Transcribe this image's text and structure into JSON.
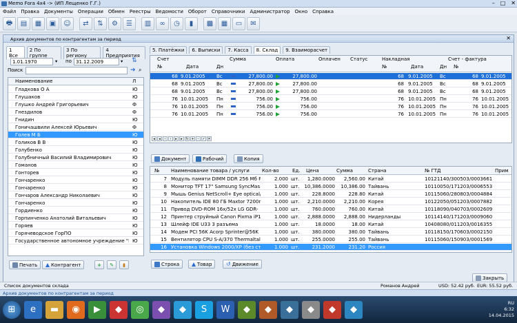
{
  "window": {
    "title": "Memo Fora 4x4 -> (ИП Лещенко Г.Г.)"
  },
  "menu": [
    "Файл",
    "Правка",
    "Документы",
    "Операции",
    "Обмен",
    "Реестры",
    "Ведомости",
    "Оборот",
    "Справочники",
    "Администратор",
    "Окно",
    "Справка"
  ],
  "toolbar_icons": [
    "printer-icon",
    "page-icon",
    "table-icon",
    "document-icon",
    "user-icon",
    "transfer-icon",
    "transfer-icon",
    "gear-icon",
    "list-icon",
    "grid-icon",
    "binoculars-icon",
    "clock-icon",
    "barcode-icon",
    "chip-icon",
    "table-icon",
    "chat-icon",
    "mail-icon"
  ],
  "doc": {
    "title": "Архив документов по контрагентам за период"
  },
  "left": {
    "tabs": [
      "1 Все",
      "2 По группе",
      "3 По региону",
      "4 Предприятия"
    ],
    "date_from": "1.01.1970",
    "date_to": "31.12.2009",
    "po": "по",
    "search_label": "Поиск",
    "col_name": "Наименование",
    "col_type": "Л",
    "rows": [
      {
        "name": "Гладкова О А",
        "t": "Ю"
      },
      {
        "name": "Глушаков",
        "t": "Ю"
      },
      {
        "name": "Глушко Андрей Григорьевич",
        "t": "Ф"
      },
      {
        "name": "Гнездилов",
        "t": "Ф"
      },
      {
        "name": "Гнидин",
        "t": "Ю"
      },
      {
        "name": "Гоничашвили Алексей Юрьевич",
        "t": "Ф"
      },
      {
        "name": "Голев М Б",
        "t": "Ю"
      },
      {
        "name": "Голиков В В",
        "t": "Ю"
      },
      {
        "name": "Голубенко",
        "t": "Ю"
      },
      {
        "name": "Голубничный Василий Владимирович",
        "t": "Ю"
      },
      {
        "name": "Гоманов",
        "t": "Ю"
      },
      {
        "name": "Гонторев",
        "t": "Ю"
      },
      {
        "name": "Гончаренко",
        "t": "Ю"
      },
      {
        "name": "Гончаренко",
        "t": "Ю"
      },
      {
        "name": "Гончаров Александр Николаевич",
        "t": "Ю"
      },
      {
        "name": "Гончаренко",
        "t": "Ю"
      },
      {
        "name": "Гордиенко",
        "t": "Ю"
      },
      {
        "name": "Горпинченко Анатолий Витальевич",
        "t": "Ю"
      },
      {
        "name": "Горяев",
        "t": "Ю"
      },
      {
        "name": "Горячеводское ГорПО",
        "t": "Ю"
      },
      {
        "name": "Государственное автономное учреждение \"Бо",
        "t": "Ю"
      }
    ],
    "print_btn": "Печать",
    "contragent_btn": "Контрагент"
  },
  "right": {
    "tabs": [
      "5. Платёжки",
      "6. Выписки",
      "7. Касса",
      "8. Склад",
      "9. Взаиморасчет"
    ],
    "head1": {
      "schet": "Счет",
      "nakl": "Накладная",
      "sf": "Счет - фактура"
    },
    "head2": {
      "n": "№",
      "date": "Дата",
      "dn": "Дн",
      "sum": "Сумма",
      "opl": "Оплата",
      "oplachen": "Оплачен",
      "status": "Статус",
      "n2": "№",
      "date2": "Дата",
      "dn2": "Дн",
      "n3": "№"
    },
    "rows": [
      {
        "n": "68",
        "date": "9.01.2005",
        "dn": "Вс",
        "sum": "27,800.00",
        "opl": "27,800.00",
        "n2": "68",
        "date2": "9.01.2005",
        "dn2": "Вс",
        "n3": "68",
        "date3": "9.01.2005"
      },
      {
        "n": "68",
        "date": "9.01.2005",
        "dn": "Вс",
        "sum": "27,800.00",
        "opl": "27,800.00",
        "n2": "68",
        "date2": "9.01.2005",
        "dn2": "Вс",
        "n3": "68",
        "date3": "9.01.2005"
      },
      {
        "n": "68",
        "date": "9.01.2005",
        "dn": "Вс",
        "sum": "27,800.00",
        "opl": "27,800.00",
        "n2": "68",
        "date2": "9.01.2005",
        "dn2": "Вс",
        "n3": "68",
        "date3": "9.01.2005"
      },
      {
        "n": "76",
        "date": "10.01.2005",
        "dn": "Пн",
        "sum": "756.00",
        "opl": "756.00",
        "n2": "76",
        "date2": "10.01.2005",
        "dn2": "Пн",
        "n3": "76",
        "date3": "10.01.2005"
      },
      {
        "n": "76",
        "date": "10.01.2005",
        "dn": "Пн",
        "sum": "756.00",
        "opl": "756.00",
        "n2": "76",
        "date2": "10.01.2005",
        "dn2": "Пн",
        "n3": "76",
        "date3": "10.01.2005"
      },
      {
        "n": "76",
        "date": "10.01.2005",
        "dn": "Пн",
        "sum": "756.00",
        "opl": "756.00",
        "n2": "76",
        "date2": "10.01.2005",
        "dn2": "Пн",
        "n3": "76",
        "date3": "10.01.2005"
      }
    ],
    "btn_doc": "Документ",
    "btn_work": "Рабочий",
    "btn_copy": "Копия",
    "items_head": {
      "n": "№",
      "name": "Наименование товара / услуги",
      "qty": "Кол-во",
      "unit": "Ед.",
      "price": "Цена",
      "sum": "Сумма",
      "country": "Страна",
      "gtd": "№ ГТД",
      "prim": "Прим"
    },
    "items": [
      {
        "n": "7",
        "name": "Модуль памяти DIMM DDR 256 Mб P",
        "qty": "2.000",
        "unit": "шт.",
        "price": "1,280.0000",
        "sum": "2,560.00",
        "country": "Китай",
        "gtd": "10121140/300503/0003661"
      },
      {
        "n": "8",
        "name": "Монитор TFT 17\" Samsung SyncMas",
        "qty": "1.000",
        "unit": "шт.",
        "price": "10,386.0000",
        "sum": "10,386.00",
        "country": "Тайвань",
        "gtd": "10110050/171203/0006553"
      },
      {
        "n": "9",
        "name": "Мышь Genius NetScroll+ Eye optical/3",
        "qty": "1.000",
        "unit": "шт.",
        "price": "228.8000",
        "sum": "228.80",
        "country": "Китай",
        "gtd": "10115060/280803/0004884"
      },
      {
        "n": "10",
        "name": "Накопитель IDE 80 ГБ Maxtor 7200rp",
        "qty": "1.000",
        "unit": "шт.",
        "price": "2,210.0000",
        "sum": "2,210.00",
        "country": "Корея",
        "gtd": "10122050/051203/0007882"
      },
      {
        "n": "11",
        "name": "Привод DVD-ROM 16x/52x LG GDR-",
        "qty": "1.000",
        "unit": "шт.",
        "price": "760.0000",
        "sum": "760.00",
        "country": "Китай",
        "gtd": "10118090/040703/0002609"
      },
      {
        "n": "12",
        "name": "Принтер струйный Canon Pixma iP1",
        "qty": "1.000",
        "unit": "шт.",
        "price": "2,888.0000",
        "sum": "2,888.00",
        "country": "Нидерланды",
        "gtd": "10114140/171203/0009060"
      },
      {
        "n": "13",
        "name": "Шлейф IDE U33 3 разъема",
        "qty": "1.000",
        "unit": "шт.",
        "price": "18.0000",
        "sum": "18.00",
        "country": "Китай",
        "gtd": "10408080/011203/0016355"
      },
      {
        "n": "14",
        "name": "Модем PCI 56K Acorp Sprinter@56K",
        "qty": "1.000",
        "unit": "шт.",
        "price": "380.0000",
        "sum": "380.00",
        "country": "Тайвань",
        "gtd": "10118150/170603/0002150"
      },
      {
        "n": "15",
        "name": "Вентилятор CPU S-A/370 Thermaltal",
        "qty": "1.000",
        "unit": "шт.",
        "price": "255.0000",
        "sum": "255.00",
        "country": "Тайвань",
        "gtd": "10115060/150903/0001569"
      },
      {
        "n": "16",
        "name": "Установка Windows 2000/XP (без ст",
        "qty": "1.000",
        "unit": "шт.",
        "price": "231.2000",
        "sum": "231.20",
        "country": "Россия",
        "gtd": ""
      }
    ],
    "btn_row": "Строка",
    "btn_goods": "Товар",
    "btn_move": "Движение",
    "close_btn": "Закрыть"
  },
  "status": {
    "left": "Список документов склада",
    "user": "Романов Андрей",
    "usd": "USD: 52.42 руб.",
    "eur": "EUR: 55.52 руб."
  },
  "taskdoc": "Архив документов по контрагентам за период",
  "tray": {
    "lang": "RU",
    "time": "6:32",
    "date": "14.04.2015"
  },
  "taskbar_icons": [
    "start-icon",
    "ie-icon",
    "folder-icon",
    "firefox-icon",
    "media-icon",
    "app-icon",
    "chrome-icon",
    "app-icon",
    "app-icon",
    "skype-icon",
    "word-icon",
    "app-icon",
    "app-icon",
    "app-icon",
    "app-icon",
    "app-icon",
    "app-icon"
  ]
}
